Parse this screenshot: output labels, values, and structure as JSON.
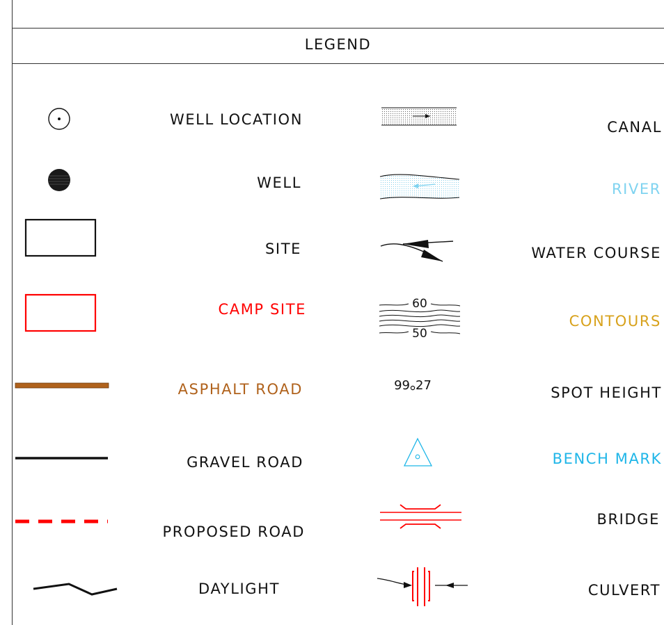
{
  "legend": {
    "title": "LEGEND",
    "left": [
      {
        "label": "WELL LOCATION",
        "color": "#111111",
        "icon": "well-location-icon"
      },
      {
        "label": "WELL",
        "color": "#111111",
        "icon": "well-icon"
      },
      {
        "label": "SITE",
        "color": "#111111",
        "icon": "site-rectangle-icon"
      },
      {
        "label": "CAMP SITE",
        "color": "#ff0000",
        "icon": "camp-site-rectangle-icon"
      },
      {
        "label": "ASPHALT ROAD",
        "color": "#b0621c",
        "icon": "asphalt-road-line-icon"
      },
      {
        "label": "GRAVEL ROAD",
        "color": "#111111",
        "icon": "gravel-road-line-icon"
      },
      {
        "label": "PROPOSED ROAD",
        "color": "#111111",
        "icon": "proposed-road-dashed-icon"
      },
      {
        "label": "DAYLIGHT",
        "color": "#111111",
        "icon": "daylight-line-icon"
      }
    ],
    "right": [
      {
        "label": "CANAL",
        "color": "#111111",
        "icon": "canal-icon"
      },
      {
        "label": "RIVER",
        "color": "#7fd3f0",
        "icon": "river-icon"
      },
      {
        "label": "WATER COURSE",
        "color": "#111111",
        "icon": "water-course-icon"
      },
      {
        "label": "CONTOURS",
        "color": "#d8a21c",
        "icon": "contours-icon"
      },
      {
        "label": "SPOT HEIGHT",
        "color": "#111111",
        "icon": "spot-height-icon"
      },
      {
        "label": "BENCH MARK",
        "color": "#1fb6e8",
        "icon": "bench-mark-icon"
      },
      {
        "label": "BRIDGE",
        "color": "#111111",
        "icon": "bridge-icon"
      },
      {
        "label": "CULVERT",
        "color": "#111111",
        "icon": "culvert-icon"
      }
    ],
    "contour_labels": {
      "upper": "60",
      "lower": "50"
    },
    "spot_height_value": "99.27",
    "spot_height_int": "99",
    "spot_height_dec": "27"
  }
}
